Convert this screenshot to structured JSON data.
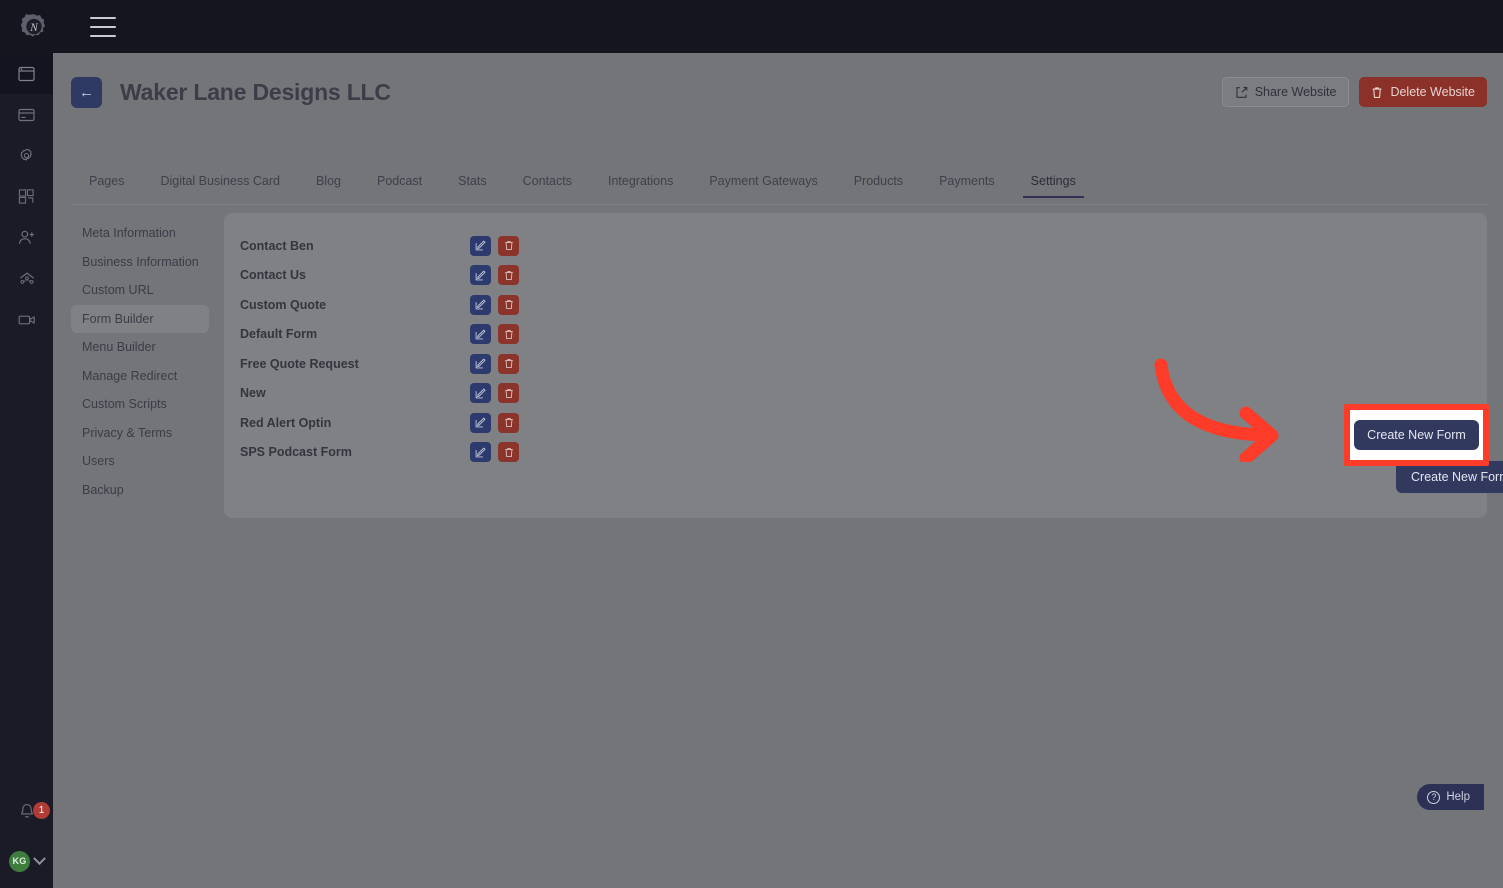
{
  "topbar": {
    "logo_label": "N",
    "menu_label": "menu"
  },
  "rail": {
    "items": [
      {
        "name": "websites",
        "icon": "browser-window-icon"
      },
      {
        "name": "cards",
        "icon": "credit-card-icon"
      },
      {
        "name": "settings",
        "icon": "gear-icon"
      },
      {
        "name": "integrations",
        "icon": "puzzle-icon"
      },
      {
        "name": "add-user",
        "icon": "user-plus-icon"
      },
      {
        "name": "team",
        "icon": "network-icon"
      },
      {
        "name": "videos",
        "icon": "video-camera-icon"
      }
    ],
    "notification_count": "1",
    "avatar_initials": "KG"
  },
  "page": {
    "back_label": "←",
    "title": "Waker Lane Designs LLC",
    "share_label": "Share Website",
    "delete_label": "Delete Website"
  },
  "tabs": [
    {
      "label": "Pages",
      "active": false
    },
    {
      "label": "Digital Business Card",
      "active": false
    },
    {
      "label": "Blog",
      "active": false
    },
    {
      "label": "Podcast",
      "active": false
    },
    {
      "label": "Stats",
      "active": false
    },
    {
      "label": "Contacts",
      "active": false
    },
    {
      "label": "Integrations",
      "active": false
    },
    {
      "label": "Payment Gateways",
      "active": false
    },
    {
      "label": "Products",
      "active": false
    },
    {
      "label": "Payments",
      "active": false
    },
    {
      "label": "Settings",
      "active": true
    }
  ],
  "subnav": [
    {
      "label": "Meta Information",
      "active": false
    },
    {
      "label": "Business Information",
      "active": false
    },
    {
      "label": "Custom URL",
      "active": false
    },
    {
      "label": "Form Builder",
      "active": true
    },
    {
      "label": "Menu Builder",
      "active": false
    },
    {
      "label": "Manage Redirect",
      "active": false
    },
    {
      "label": "Custom Scripts",
      "active": false
    },
    {
      "label": "Privacy & Terms",
      "active": false
    },
    {
      "label": "Users",
      "active": false
    },
    {
      "label": "Backup",
      "active": false
    }
  ],
  "forms": [
    {
      "name": "Contact Ben"
    },
    {
      "name": "Contact Us"
    },
    {
      "name": "Custom Quote"
    },
    {
      "name": "Default Form"
    },
    {
      "name": "Free Quote Request"
    },
    {
      "name": "New"
    },
    {
      "name": "Red Alert Optin"
    },
    {
      "name": "SPS Podcast Form"
    }
  ],
  "actions": {
    "edit_icon": "pencil-square-icon",
    "delete_icon": "trash-icon",
    "create_label": "Create New Form"
  },
  "help": {
    "label": "Help",
    "icon": "question-circle-icon"
  },
  "annotation": {
    "highlight_color": "#fc3b28",
    "arrow": "curved-arrow-right"
  },
  "colors": {
    "overlay": "#747578",
    "card": "#808184",
    "primary": "#32395f",
    "danger": "#8c3129",
    "topbar": "#14151e",
    "rail": "#1a1b26",
    "avatar": "#3f7d3f"
  }
}
